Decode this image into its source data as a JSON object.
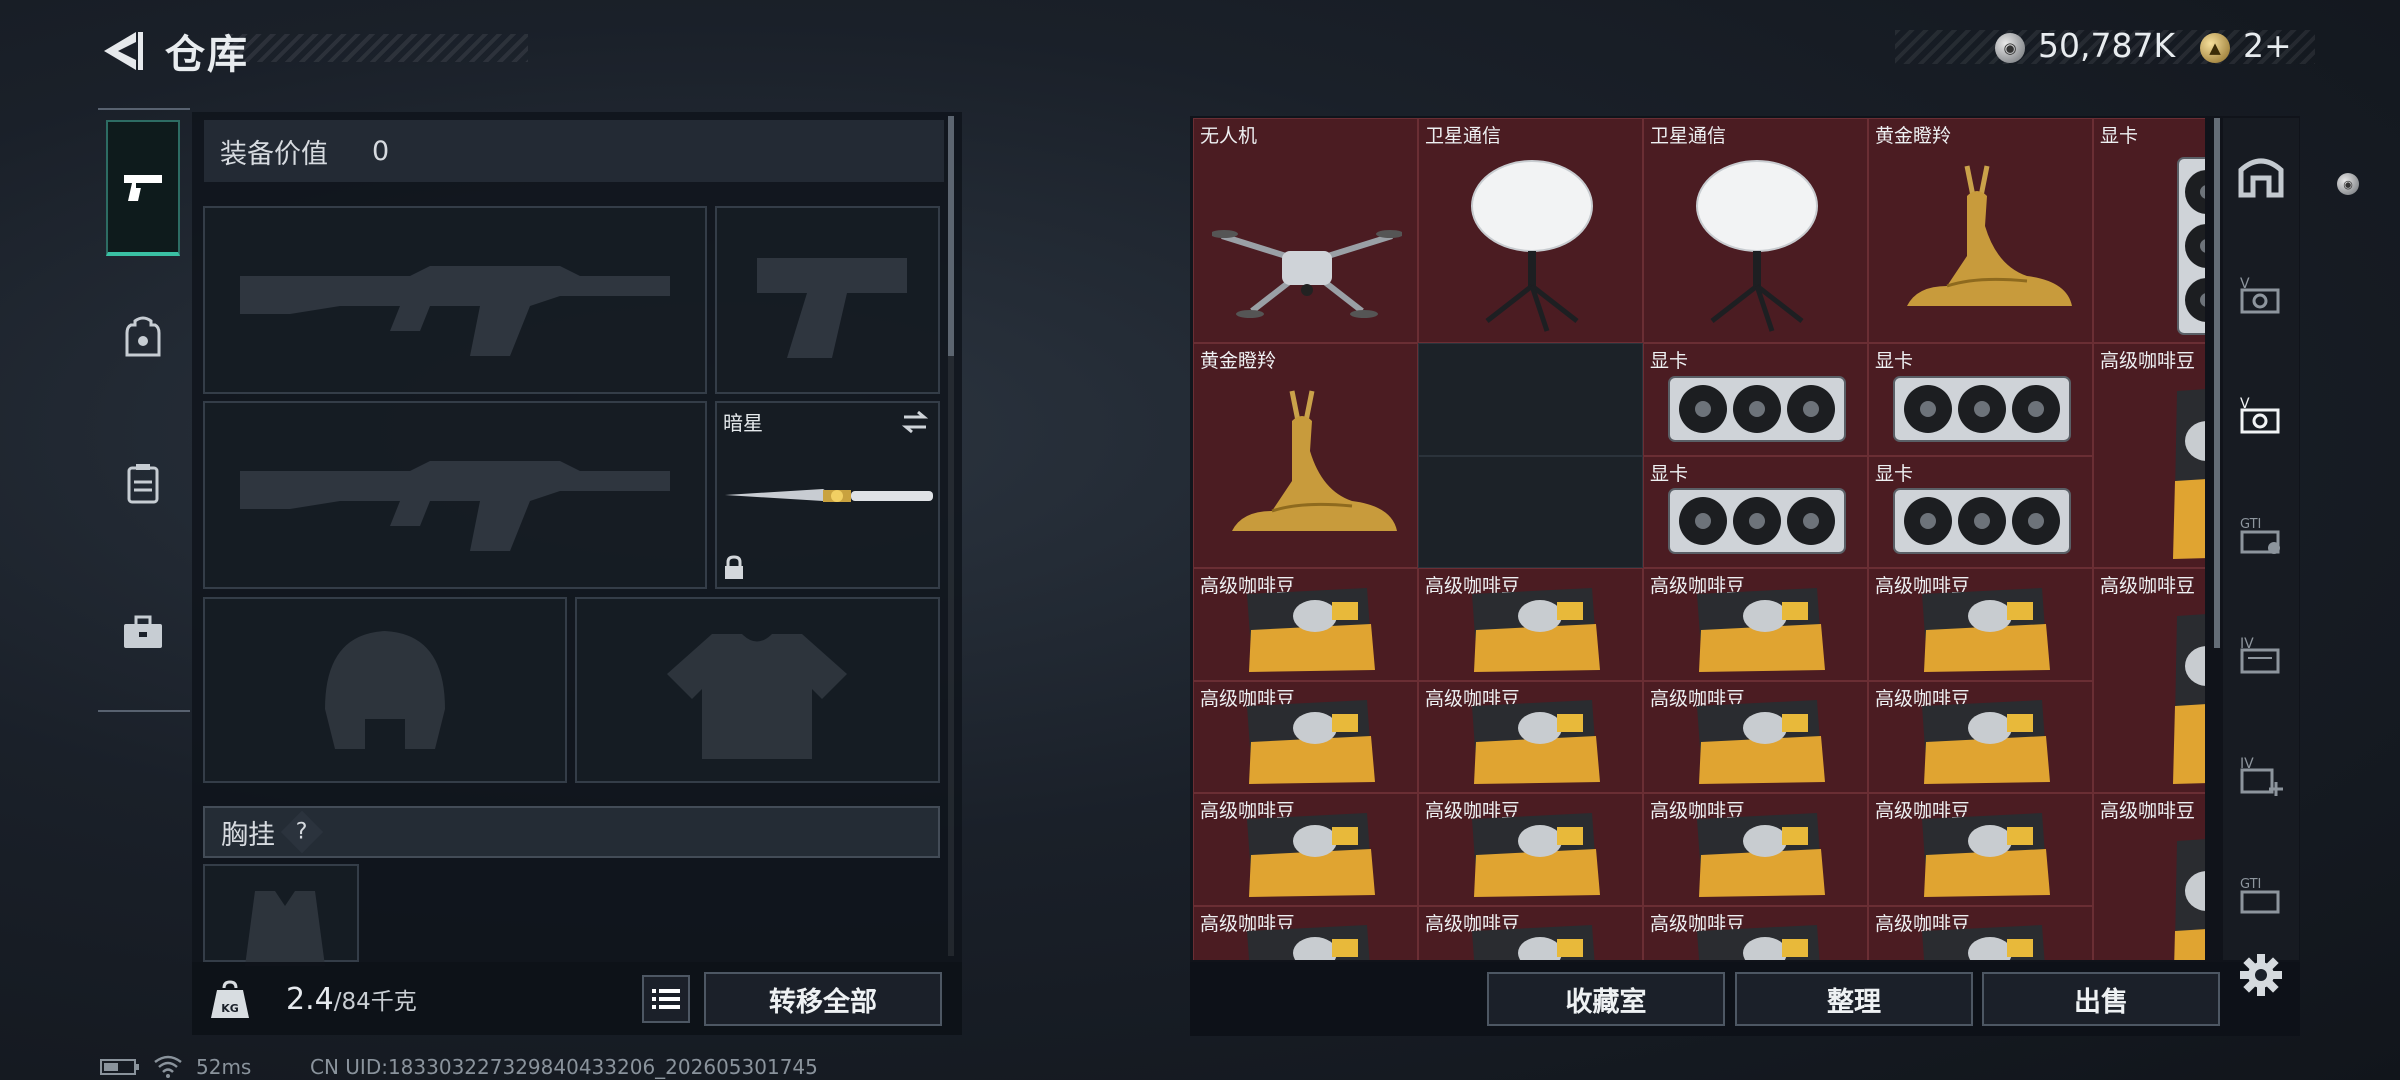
{
  "header": {
    "title": "仓库",
    "currency_silver": "50,787K",
    "currency_gold": "2+"
  },
  "left_tabs": [
    "pistol-icon",
    "backpack-icon",
    "vest-icon",
    "toolbox-icon"
  ],
  "equipment": {
    "value_label": "装备价值",
    "value": "0",
    "knife_slot_label": "暗星",
    "chest_rig_label": "胸挂",
    "chest_rig_help": "?"
  },
  "footer_left": {
    "weight_current": "2.4",
    "weight_max": "/84千克",
    "transfer_all": "转移全部"
  },
  "status": {
    "ping": "52ms",
    "uid": "CN UID:183303227329840433206_202605301745"
  },
  "stash": {
    "items": [
      {
        "label": "无人机",
        "icon": "drone-icon"
      },
      {
        "label": "卫星通信",
        "icon": "satellite-dish-icon"
      },
      {
        "label": "卫星通信",
        "icon": "satellite-dish-icon"
      },
      {
        "label": "黄金瞪羚",
        "icon": "golden-gazelle-icon"
      },
      {
        "label": "显卡",
        "icon": "gpu-icon"
      },
      {
        "label": "黄金瞪羚",
        "icon": "golden-gazelle-icon"
      },
      {
        "label": "显卡",
        "icon": "gpu-icon"
      },
      {
        "label": "显卡",
        "icon": "gpu-icon"
      },
      {
        "label": "高级咖啡豆",
        "icon": "coffee-bag-icon"
      },
      {
        "label": "显卡",
        "icon": "gpu-icon"
      },
      {
        "label": "显卡",
        "icon": "gpu-icon"
      },
      {
        "label": "高级咖啡豆",
        "icon": "coffee-bag-icon"
      },
      {
        "label": "高级咖啡豆",
        "icon": "coffee-bag-icon"
      },
      {
        "label": "高级咖啡豆",
        "icon": "coffee-bag-icon"
      },
      {
        "label": "高级咖啡豆",
        "icon": "coffee-bag-icon"
      },
      {
        "label": "高级咖啡豆",
        "icon": "coffee-bag-icon"
      },
      {
        "label": "高级咖啡豆",
        "icon": "coffee-bag-icon"
      },
      {
        "label": "高级咖啡豆",
        "icon": "coffee-bag-icon"
      },
      {
        "label": "高级咖啡豆",
        "icon": "coffee-bag-icon"
      },
      {
        "label": "高级咖啡豆",
        "icon": "coffee-bag-icon"
      },
      {
        "label": "高级咖啡豆",
        "icon": "coffee-bag-icon"
      },
      {
        "label": "高级咖啡豆",
        "icon": "coffee-bag-icon"
      },
      {
        "label": "高级咖啡豆",
        "icon": "coffee-bag-icon"
      },
      {
        "label": "高级咖啡豆",
        "icon": "coffee-bag-icon"
      },
      {
        "label": "高级咖啡豆",
        "icon": "coffee-bag-icon"
      },
      {
        "label": "高级咖啡豆",
        "icon": "coffee-bag-icon"
      },
      {
        "label": "高级咖啡豆",
        "icon": "coffee-bag-icon"
      },
      {
        "label": "高级咖啡豆",
        "icon": "coffee-bag-icon"
      },
      {
        "label": "高级咖啡豆",
        "icon": "coffee-bag-icon"
      }
    ]
  },
  "right_tabs": [
    "warehouse-icon",
    "v-slot-icon",
    "v-slot-active-icon",
    "gti-slot-icon",
    "iv-slot-icon",
    "iv-add-slot-icon",
    "gti-slot-2-icon"
  ],
  "actions": {
    "collection": "收藏室",
    "sort": "整理",
    "sell": "出售"
  }
}
